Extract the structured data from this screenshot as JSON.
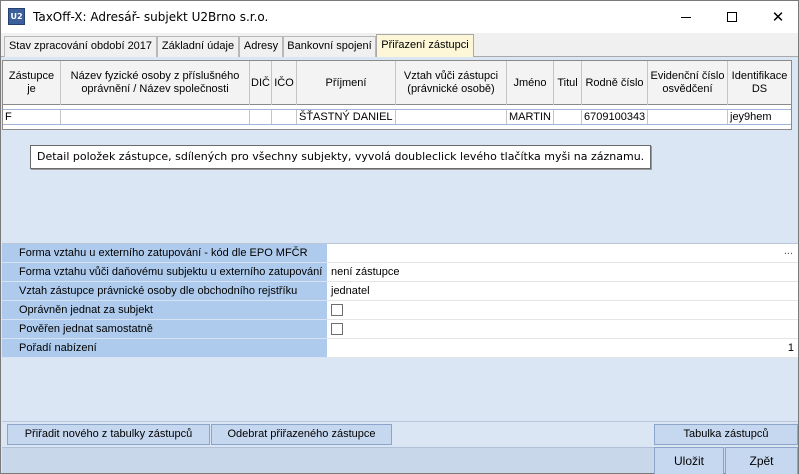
{
  "window": {
    "title": "TaxOff-X: Adresář- subjekt U2Brno s.r.o.",
    "icon_text": "U2"
  },
  "tabs": [
    {
      "label": "Stav zpracování období 2017",
      "active": false
    },
    {
      "label": "Základní údaje",
      "active": false
    },
    {
      "label": "Adresy",
      "active": false
    },
    {
      "label": "Bankovní spojení",
      "active": false
    },
    {
      "label": "Přiřazení zástupci",
      "active": true
    }
  ],
  "grid": {
    "columns": [
      "Zástupce je",
      "Název fyzické osoby z příslušného oprávnění / Název společnosti",
      "DIČ",
      "IČO",
      "Příjmení",
      "Vztah vůči zástupci (právnické osobě)",
      "Jméno",
      "Titul",
      "Rodně číslo",
      "Evidenční číslo osvědčení",
      "Identifikace DS"
    ],
    "rows": [
      [
        "F",
        "",
        "",
        "",
        "ŠŤASTNÝ DANIEL",
        "",
        "MARTIN",
        "",
        "6709100343",
        "",
        "jey9hem"
      ]
    ]
  },
  "hint": "Detail položek zástupce, sdílených pro všechny subjekty, vyvolá doubleclick levého tlačítka myši na záznamu.",
  "properties": [
    {
      "label": "Forma vztahu u externího zatupování - kód dle EPO MFČR",
      "value": "",
      "type": "ellipsis",
      "ellipsis": "..."
    },
    {
      "label": "Forma vztahu vůči daňovému subjektu u externího zatupování",
      "value": "není zástupce",
      "type": "text"
    },
    {
      "label": "Vztah zástupce právnické osoby dle obchodního rejstříku",
      "value": "jednatel",
      "type": "text"
    },
    {
      "label": "Oprávněn jednat za subjekt",
      "value": false,
      "type": "checkbox"
    },
    {
      "label": "Pověřen jednat samostatně",
      "value": false,
      "type": "checkbox"
    },
    {
      "label": "Pořadí nabízení",
      "value": "1",
      "type": "number"
    }
  ],
  "buttons": {
    "assign_new": "Přiřadit nového z tabulky zástupců",
    "remove_assigned": "Odebrat přiřazeného zástupce",
    "representatives_table": "Tabulka zástupců",
    "save": "Uložit",
    "back": "Zpět"
  }
}
